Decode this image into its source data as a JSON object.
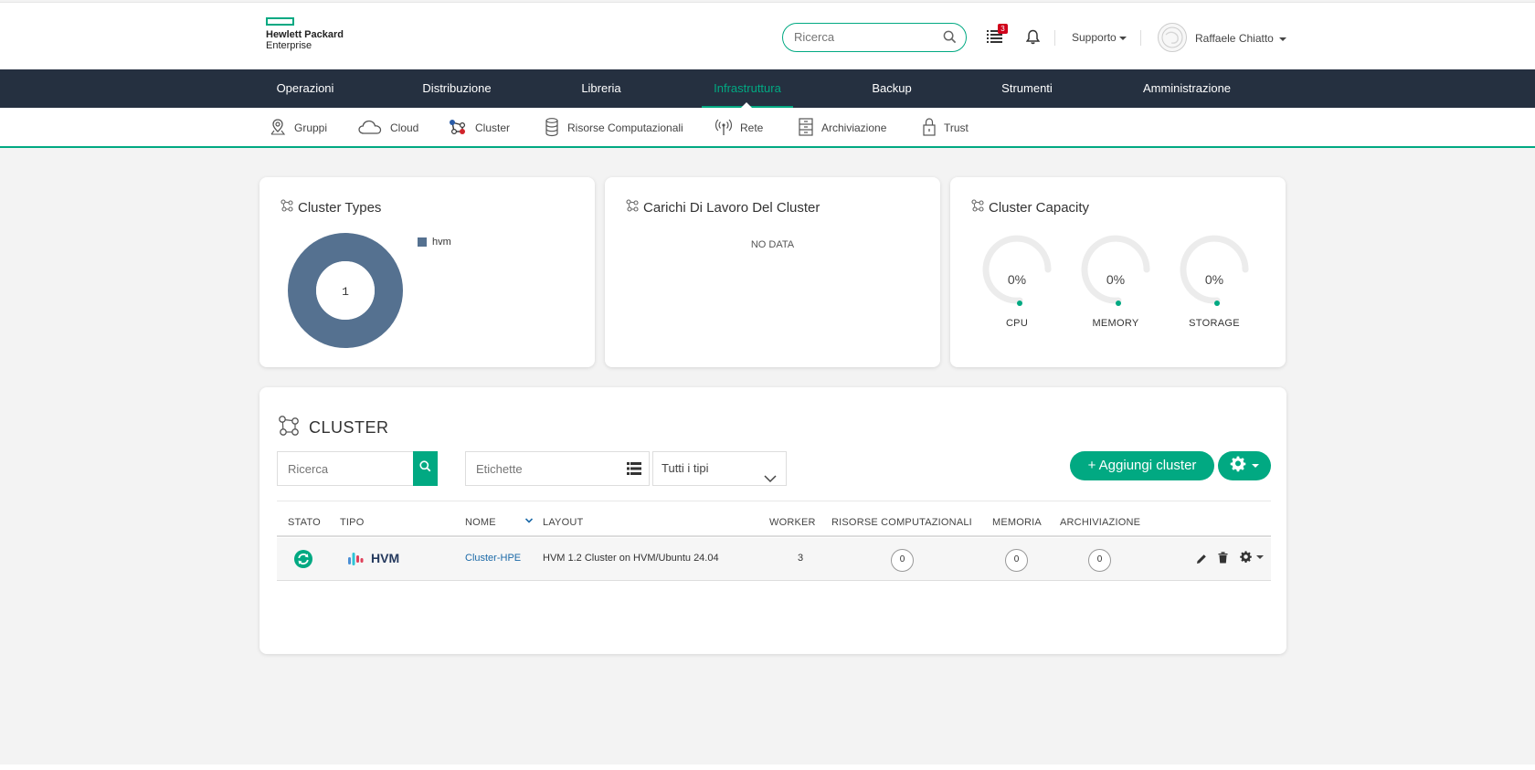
{
  "header": {
    "logo_line1": "Hewlett Packard",
    "logo_line2": "Enterprise",
    "search_placeholder": "Ricerca",
    "tasks_badge": "3",
    "support_label": "Supporto",
    "user_name": "Raffaele Chiatto"
  },
  "main_nav": {
    "items": [
      "Operazioni",
      "Distribuzione",
      "Libreria",
      "Infrastruttura",
      "Backup",
      "Strumenti",
      "Amministrazione"
    ],
    "active": "Infrastruttura"
  },
  "sub_nav": {
    "items": [
      "Gruppi",
      "Cloud",
      "Cluster",
      "Risorse Computazionali",
      "Rete",
      "Archiviazione",
      "Trust"
    ],
    "active": "Cluster"
  },
  "cards": {
    "types": {
      "title": "Cluster Types",
      "center_value": "1",
      "legend_label": "hvm"
    },
    "workloads": {
      "title": "Carichi Di Lavoro Del Cluster",
      "empty_text": "NO DATA"
    },
    "capacity": {
      "title": "Cluster Capacity",
      "gauges": [
        {
          "label": "CPU",
          "value": "0%"
        },
        {
          "label": "MEMORY",
          "value": "0%"
        },
        {
          "label": "STORAGE",
          "value": "0%"
        }
      ]
    }
  },
  "cluster_panel": {
    "title": "CLUSTER",
    "search_placeholder": "Ricerca",
    "tags_placeholder": "Etichette",
    "type_select": "Tutti i tipi",
    "add_button": "+ Aggiungi cluster",
    "columns": [
      "STATO",
      "TIPO",
      "NOME",
      "LAYOUT",
      "WORKER",
      "RISORSE COMPUTAZIONALI",
      "MEMORIA",
      "ARCHIVIAZIONE"
    ],
    "rows": [
      {
        "type": "HVM",
        "name": "Cluster-HPE",
        "layout": "HVM 1.2 Cluster on HVM/Ubuntu 24.04",
        "workers": "3",
        "compute": "0",
        "memory": "0",
        "storage": "0"
      }
    ]
  },
  "colors": {
    "accent": "#01a982",
    "nav_bg": "#253040",
    "donut": "#557190"
  }
}
